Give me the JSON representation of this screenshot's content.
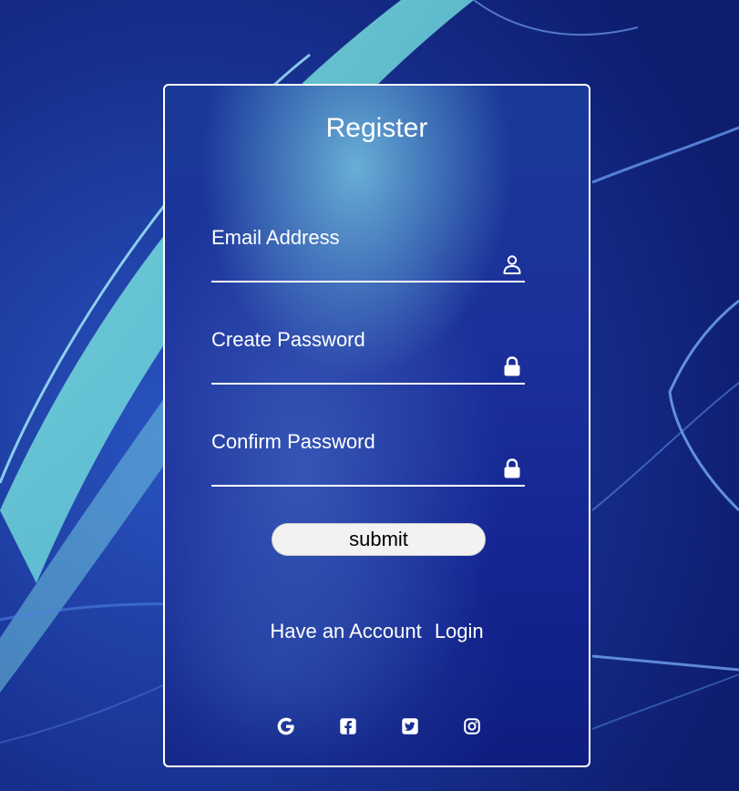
{
  "form": {
    "title": "Register",
    "email_label": "Email Address",
    "email_value": "",
    "password_label": "Create Password",
    "password_value": "",
    "confirm_label": "Confirm Password",
    "confirm_value": "",
    "submit_label": "submit",
    "account_text": "Have an Account",
    "login_label": "Login"
  },
  "icons": {
    "email": "user-icon",
    "password": "lock-icon",
    "confirm": "lock-icon",
    "social": [
      "google-icon",
      "facebook-icon",
      "twitter-icon",
      "instagram-icon"
    ]
  },
  "colors": {
    "background": "#142a8a",
    "accent_light": "#7ad8e0",
    "text": "#ffffff",
    "button_bg": "#f2f2f2"
  }
}
